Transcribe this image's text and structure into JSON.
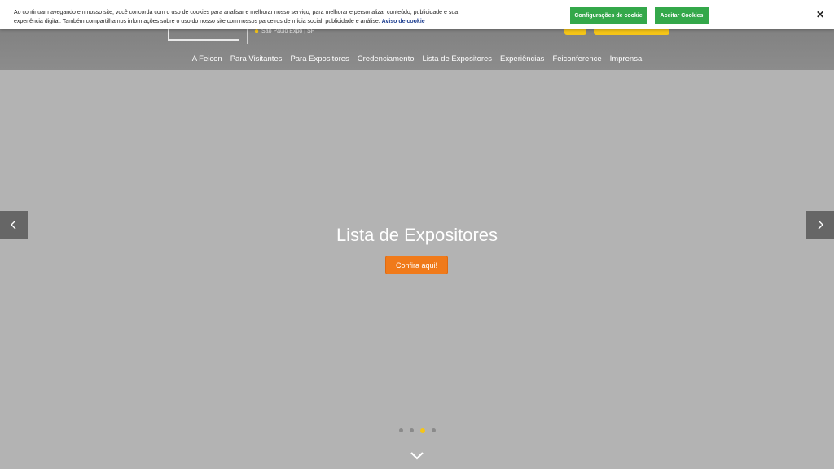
{
  "cookie_banner": {
    "text": "Ao continuar navegando em nosso site, você concorda com o uso de cookies para analisar e melhorar nosso serviço, para melhorar e personalizar conteúdo, publicidade e sua experiência digital. Também compartilhamos informações sobre o uso do nosso site com nossos parceiros de mídia social, publicidade e análise.",
    "link": "Aviso de cookie",
    "settings_button": "Configurações de cookie",
    "accept_button": "Aceitar Cookies",
    "close_icon": "close-icon"
  },
  "header": {
    "venue": "São Paulo Expo | SP",
    "nav": [
      "A Feicon",
      "Para Visitantes",
      "Para Expositores",
      "Credenciamento",
      "Lista de Expositores",
      "Experiências",
      "Feiconference",
      "Imprensa"
    ]
  },
  "hero": {
    "title": "Lista de Expositores",
    "cta": "Confira aqui!",
    "slide_count": 4,
    "active_slide": 3
  },
  "colors": {
    "accent_yellow": "#f5c518",
    "cta_orange": "#f07a1a",
    "cookie_green": "#34a84a"
  }
}
